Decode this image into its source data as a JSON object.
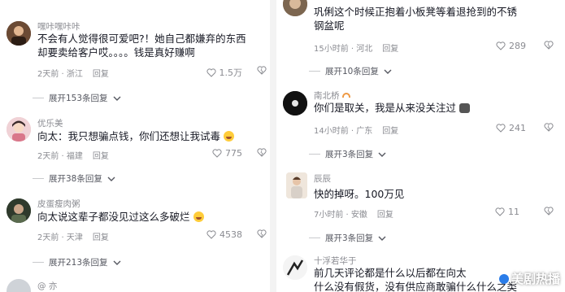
{
  "colors": {
    "username": "#8a8b91",
    "text": "#161823",
    "meta": "#8a8b91",
    "expand": "#555760",
    "background": "#ffffff"
  },
  "icons": {
    "like": "heart-outline-icon",
    "dislike": "broken-heart-outline-icon",
    "expand": "chevron-down-icon"
  },
  "left_column": {
    "comments": [
      {
        "username": "嘿咔嘿咔咔",
        "lines": [
          "不会有人觉得很可爱吧?！她自己都嫌弃的东西",
          "却要卖给客户哎。。。。钱是真好赚啊"
        ],
        "time": "2天前 · 浙江",
        "reply": "回复",
        "likes": "1.5万",
        "expand": "展开153条回复"
      },
      {
        "username": "优乐美",
        "lines": [
          "向太：我只想骗点钱，你们还想让我试毒"
        ],
        "time": "2天前 · 福建",
        "reply": "回复",
        "likes": "775",
        "expand": "展开38条回复"
      },
      {
        "username": "皮蛋瘦肉粥",
        "lines": [
          "向太说这辈子都没见过这么多破烂"
        ],
        "time": "2天前 · 天津",
        "reply": "回复",
        "likes": "4538",
        "expand": "展开213条回复"
      },
      {
        "username": "@ 亦",
        "lines": [],
        "time": "",
        "reply": "",
        "likes": "",
        "expand": ""
      }
    ]
  },
  "right_column": {
    "comments": [
      {
        "username": "",
        "lines": [
          "巩俐这个时候正抱着小板凳等着退抢到的不锈",
          "钢盆呢"
        ],
        "time": "15小时前 · 河北",
        "reply": "回复",
        "likes": "289",
        "expand": "展开10条回复"
      },
      {
        "username": "南北桥",
        "lines": [
          "你们是取关，我是从来没关注过"
        ],
        "time": "14小时前 · 广东",
        "reply": "回复",
        "likes": "241",
        "expand": "展开3条回复"
      },
      {
        "username": "辰辰",
        "lines": [
          "快的掉呀。100万见"
        ],
        "time": "7小时前 · 安徽",
        "reply": "回复",
        "likes": "11",
        "expand": "展开3条回复"
      },
      {
        "username": "十浮若华于",
        "lines": [
          "前几天评论都是什么以后都在向太",
          "什么没有假货，没有供应商敢骗什么什么之类"
        ],
        "time": "",
        "reply": "",
        "likes": "",
        "expand": ""
      }
    ]
  },
  "watermark": "美剧热播"
}
